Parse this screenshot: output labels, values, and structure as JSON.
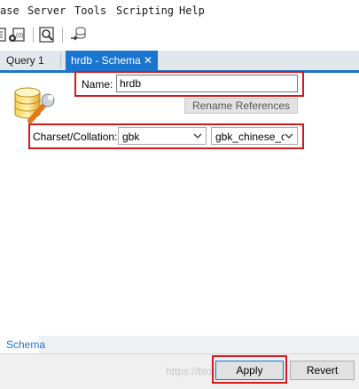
{
  "menu": {
    "items": [
      "ase",
      "Server",
      "Tools",
      "Scripting",
      "Help"
    ]
  },
  "toolbar": {
    "icons": [
      "new-sql-tab-icon",
      "add-schema-icon",
      "inspector-icon",
      "migration-icon"
    ]
  },
  "tabs": {
    "query_label": "Query 1",
    "schema_label": "hrdb - Schema",
    "close_glyph": "✕",
    "active_color": "#1b76d0"
  },
  "form": {
    "name_label": "Name:",
    "name_value": "hrdb",
    "rename_button": "Rename References",
    "charset_label": "Charset/Collation:",
    "charset_value": "gbk",
    "collation_value": "gbk_chinese_ci"
  },
  "bottom_tabs": {
    "schema_label": "Schema"
  },
  "footer": {
    "apply_label": "Apply",
    "revert_label": "Revert",
    "watermark": "https://blog.csdn.net/..."
  },
  "colors": {
    "highlight": "#d7191c",
    "accent": "#1b76d0"
  }
}
